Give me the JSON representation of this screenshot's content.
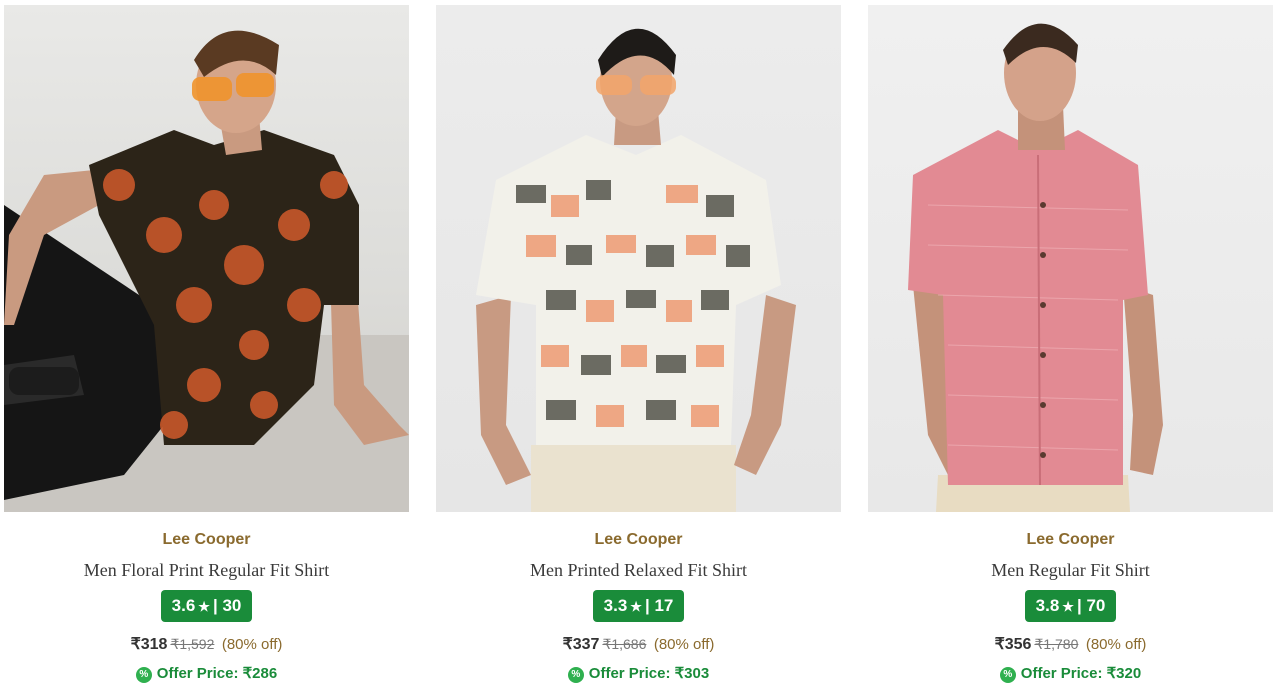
{
  "products": [
    {
      "brand": "Lee Cooper",
      "title": "Men Floral Print Regular Fit Shirt",
      "rating": "3.6",
      "reviews": "30",
      "price": "₹318",
      "mrp": "₹1,592",
      "discount": "(80% off)",
      "offer_label": "Offer Price: ₹286",
      "image_icon": "model-photo-floral-shirt"
    },
    {
      "brand": "Lee Cooper",
      "title": "Men Printed Relaxed Fit Shirt",
      "rating": "3.3",
      "reviews": "17",
      "price": "₹337",
      "mrp": "₹1,686",
      "discount": "(80% off)",
      "offer_label": "Offer Price: ₹303",
      "image_icon": "model-photo-printed-shirt"
    },
    {
      "brand": "Lee Cooper",
      "title": "Men Regular Fit Shirt",
      "rating": "3.8",
      "reviews": "70",
      "price": "₹356",
      "mrp": "₹1,780",
      "discount": "(80% off)",
      "offer_label": "Offer Price: ₹320",
      "image_icon": "model-photo-pink-shirt"
    }
  ],
  "colors": {
    "brand": "#8a6a2e",
    "rating_bg": "#1a8c3a",
    "offer": "#1a8c3a"
  }
}
